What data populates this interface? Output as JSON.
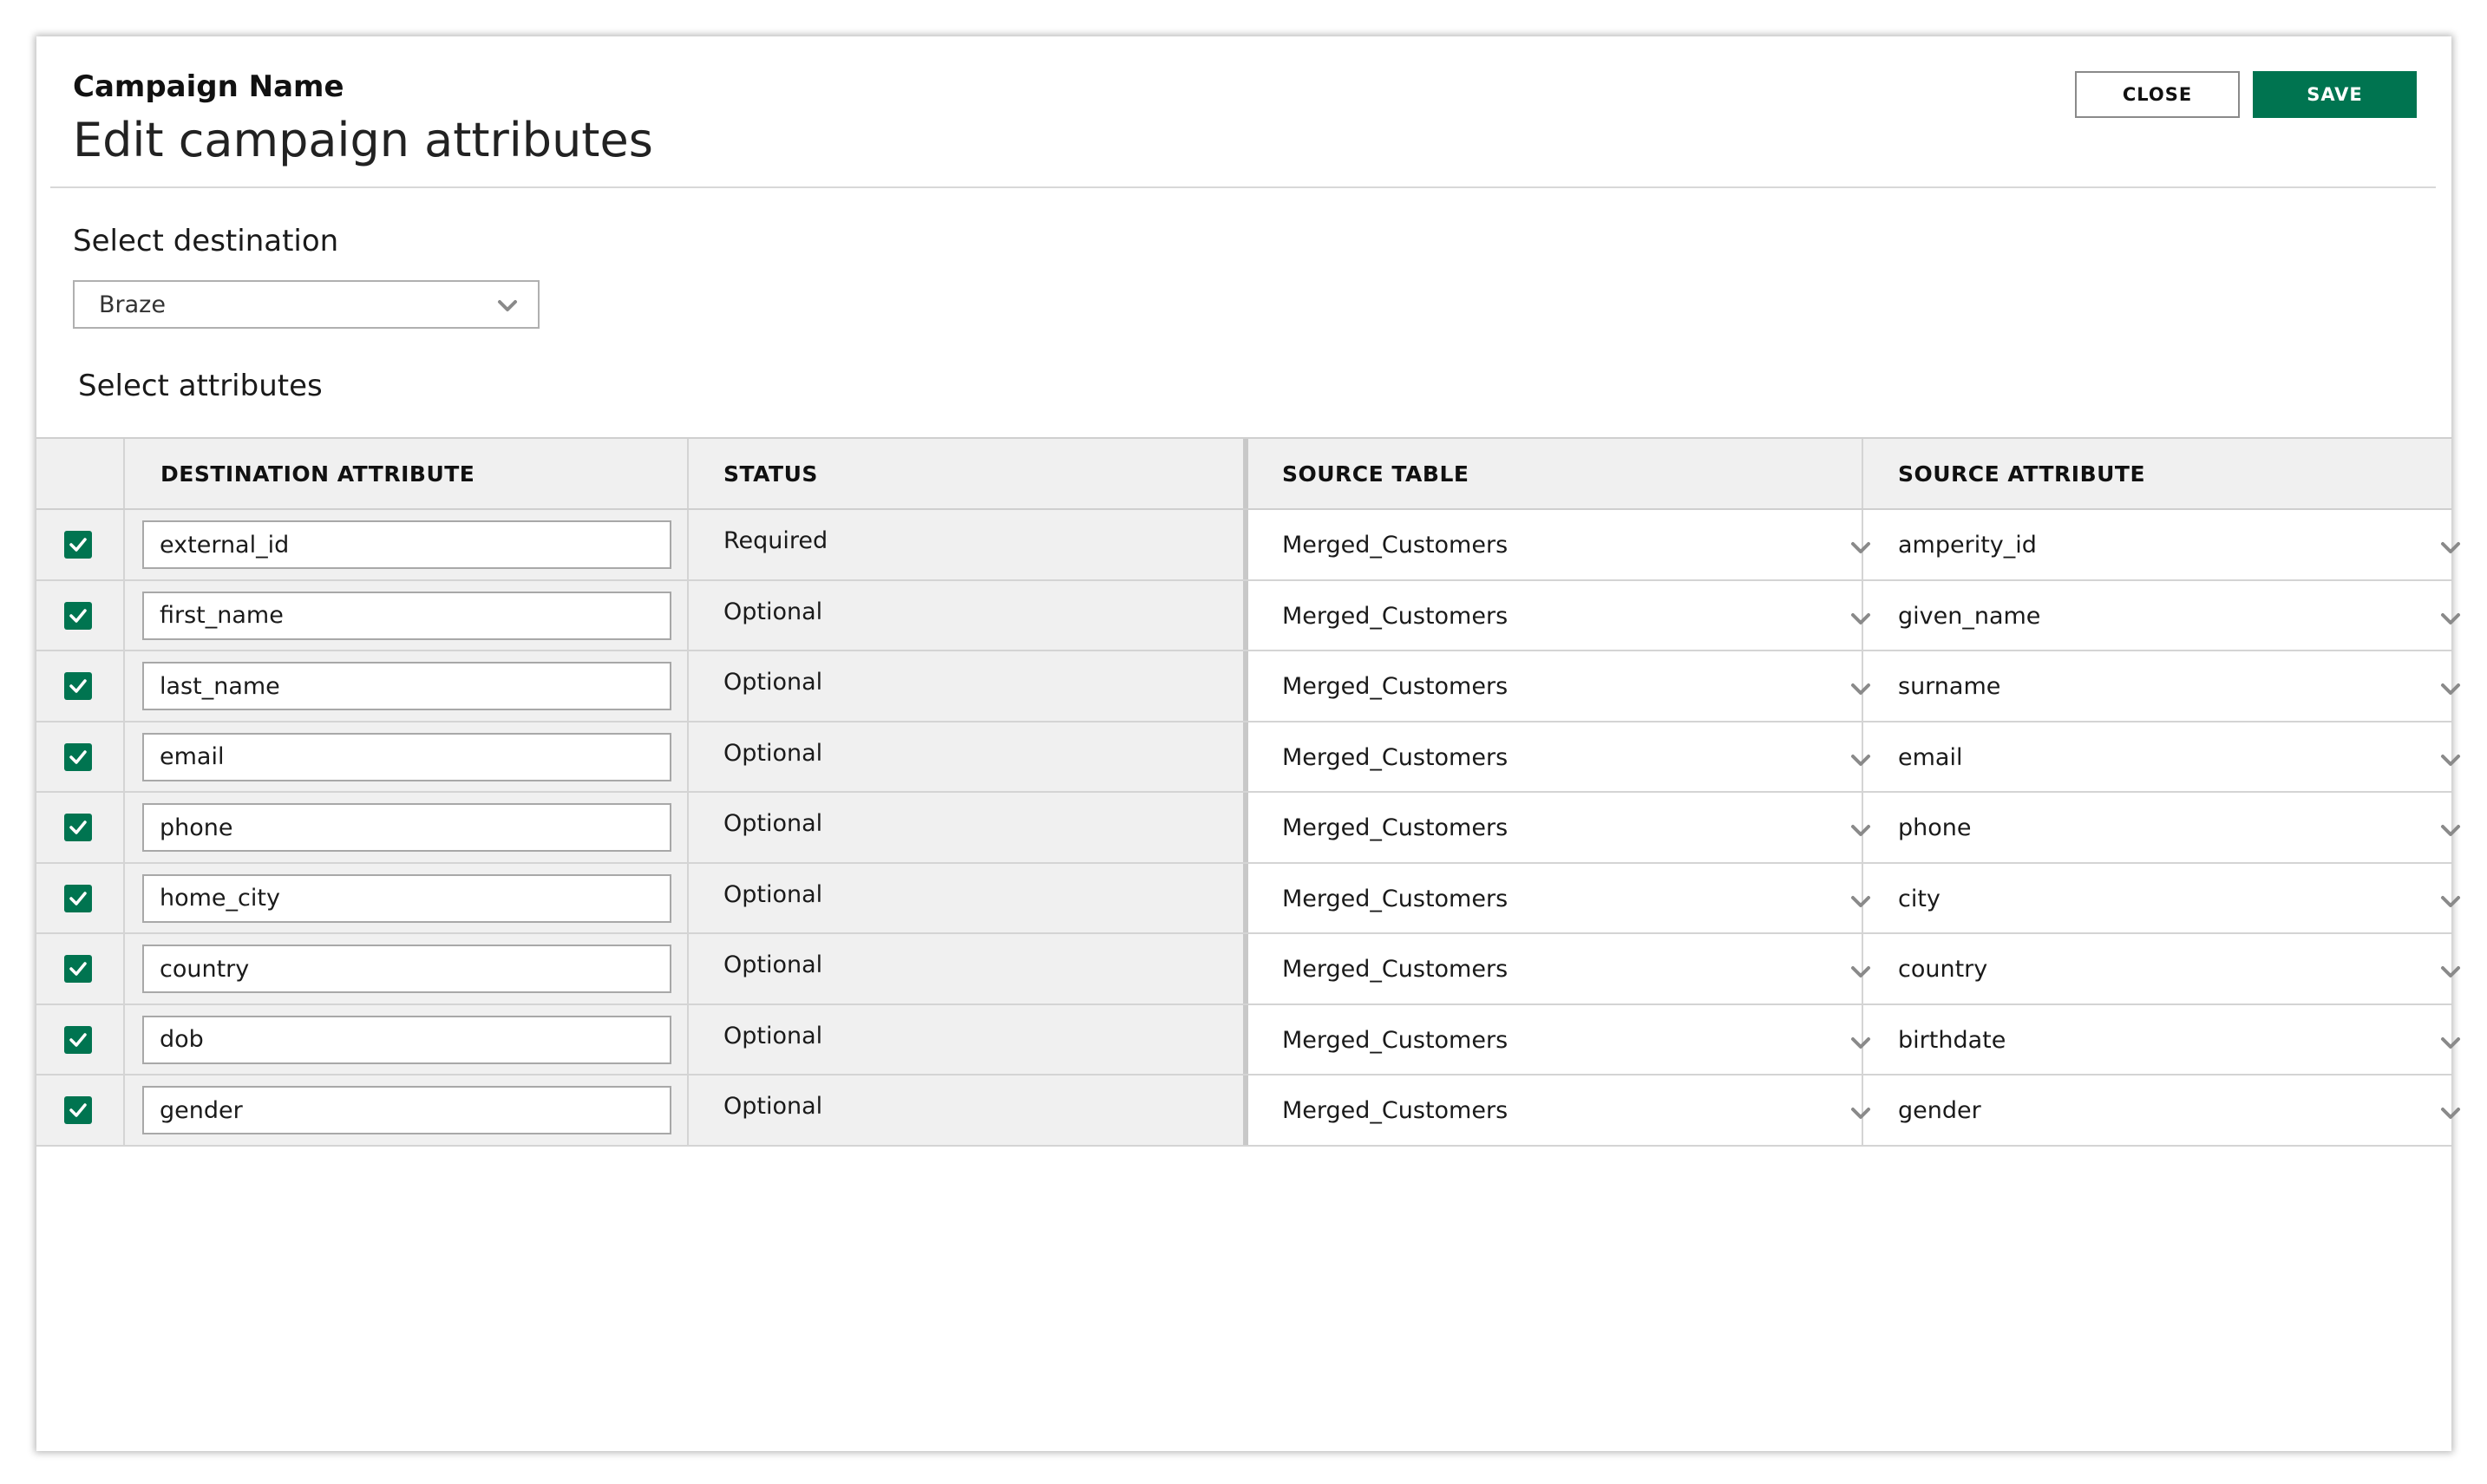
{
  "header": {
    "subtitle": "Campaign Name",
    "title": "Edit campaign attributes",
    "close_label": "CLOSE",
    "save_label": "SAVE"
  },
  "destination": {
    "label": "Select destination",
    "selected": "Braze"
  },
  "attributes": {
    "label": "Select attributes",
    "columns": [
      "DESTINATION ATTRIBUTE",
      "STATUS",
      "SOURCE TABLE",
      "SOURCE ATTRIBUTE"
    ],
    "rows": [
      {
        "checked": true,
        "destination_attribute": "external_id",
        "status": "Required",
        "source_table": "Merged_Customers",
        "source_attribute": "amperity_id"
      },
      {
        "checked": true,
        "destination_attribute": "first_name",
        "status": "Optional",
        "source_table": "Merged_Customers",
        "source_attribute": "given_name"
      },
      {
        "checked": true,
        "destination_attribute": "last_name",
        "status": "Optional",
        "source_table": "Merged_Customers",
        "source_attribute": "surname"
      },
      {
        "checked": true,
        "destination_attribute": "email",
        "status": "Optional",
        "source_table": "Merged_Customers",
        "source_attribute": "email"
      },
      {
        "checked": true,
        "destination_attribute": "phone",
        "status": "Optional",
        "source_table": "Merged_Customers",
        "source_attribute": "phone"
      },
      {
        "checked": true,
        "destination_attribute": "home_city",
        "status": "Optional",
        "source_table": "Merged_Customers",
        "source_attribute": "city"
      },
      {
        "checked": true,
        "destination_attribute": "country",
        "status": "Optional",
        "source_table": "Merged_Customers",
        "source_attribute": "country"
      },
      {
        "checked": true,
        "destination_attribute": "dob",
        "status": "Optional",
        "source_table": "Merged_Customers",
        "source_attribute": "birthdate"
      },
      {
        "checked": true,
        "destination_attribute": "gender",
        "status": "Optional",
        "source_table": "Merged_Customers",
        "source_attribute": "gender"
      }
    ]
  },
  "colors": {
    "accent": "#007450",
    "header_bg": "#f0f0f0",
    "border": "#d4d4d4"
  },
  "icons": {
    "dropdown": "chevron-down-icon",
    "checkbox": "check-icon"
  }
}
